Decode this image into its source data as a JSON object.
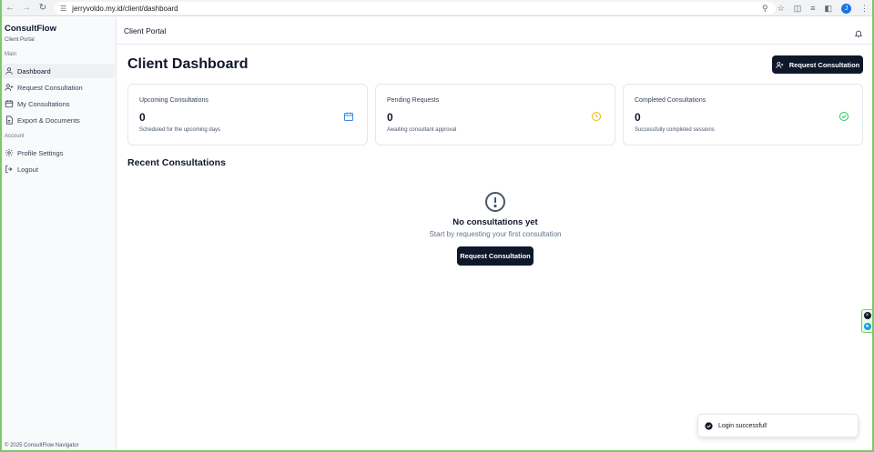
{
  "browser": {
    "url": "jerryvoldo.my.id/client/dashboard",
    "avatar_letter": "J"
  },
  "sidebar": {
    "brand": "ConsultFlow",
    "brand_sub": "Client Portal",
    "section_main": "Main",
    "section_account": "Account",
    "items": [
      {
        "label": "Dashboard",
        "icon": "user-icon"
      },
      {
        "label": "Request Consultation",
        "icon": "user-plus-icon"
      },
      {
        "label": "My Consultations",
        "icon": "calendar-icon"
      },
      {
        "label": "Export & Documents",
        "icon": "file-icon"
      },
      {
        "label": "Profile Settings",
        "icon": "gear-icon"
      },
      {
        "label": "Logout",
        "icon": "logout-icon"
      }
    ],
    "footer": "© 2025 ConsultFlow Navigator"
  },
  "header": {
    "title": "Client Portal"
  },
  "main": {
    "page_title": "Client Dashboard",
    "request_button_label": "Request Consultation",
    "cards": [
      {
        "label": "Upcoming Consultations",
        "value": "0",
        "desc": "Scheduled for the upcoming days",
        "icon": "calendar-icon",
        "color": "#3b82f6"
      },
      {
        "label": "Pending Requests",
        "value": "0",
        "desc": "Awaiting consultant approval",
        "icon": "clock-icon",
        "color": "#eab308"
      },
      {
        "label": "Completed Consultations",
        "value": "0",
        "desc": "Successfully completed sessions",
        "icon": "check-circle-icon",
        "color": "#22c55e"
      }
    ],
    "recent_title": "Recent Consultations",
    "empty": {
      "title": "No consultations yet",
      "subtitle": "Start by requesting your first consultation",
      "button_label": "Request Consultation"
    }
  },
  "toast": {
    "message": "Login successful!"
  },
  "colors": {
    "primary": "#0f172a",
    "frame": "#7cc96a"
  }
}
